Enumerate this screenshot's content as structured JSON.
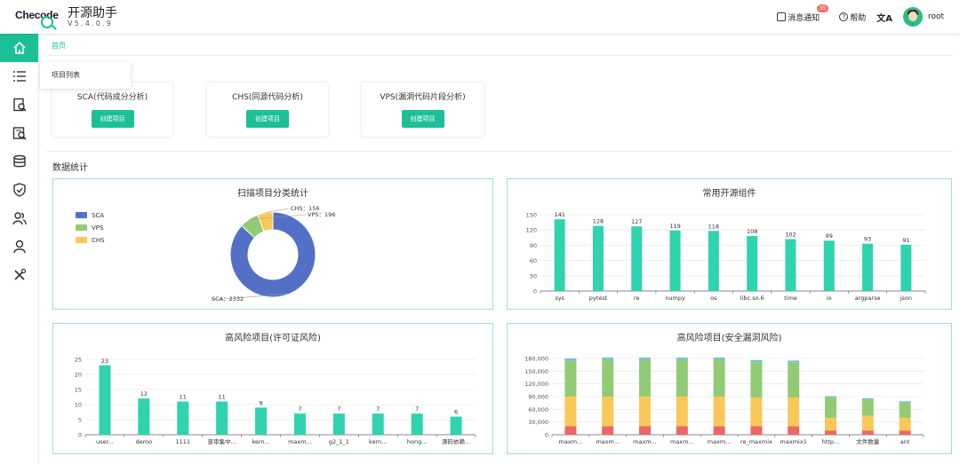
{
  "header": {
    "app_name": "开源助手",
    "version": "V5.4.0.9",
    "notice_label": "消息通知",
    "notice_count": "35",
    "help_label": "帮助",
    "lang_icon": "文A",
    "user_name": "root"
  },
  "breadcrumb": "首页",
  "tooltip": "项目列表",
  "cards": [
    {
      "title": "SCA(代码成分分析)",
      "button": "创建项目"
    },
    {
      "title": "CHS(同源代码分析)",
      "button": "创建项目"
    },
    {
      "title": "VPS(漏洞代码片段分析)",
      "button": "创建项目"
    }
  ],
  "section_title": "数据统计",
  "panels": {
    "pie_title": "扫描项目分类统计",
    "components_title": "常用开源组件",
    "license_title": "高风险项目(许可证风险)",
    "vuln_title": "高风险项目(安全漏洞风险)"
  },
  "colors": {
    "accent": "#1dbf97",
    "bar": "#2fd3ae",
    "sca": "#5470c6",
    "vps": "#91cc75",
    "chs": "#fac858",
    "red": "#ee6666",
    "blue": "#73c0de"
  },
  "chart_data": [
    {
      "type": "pie",
      "categories": [
        "SCA",
        "VPS",
        "CHS"
      ],
      "values": [
        2332,
        196,
        156
      ],
      "labels": [
        "SCA：2332",
        "VPS：196",
        "CHS：156"
      ],
      "legend": "left"
    },
    {
      "type": "bar",
      "categories": [
        "sys",
        "pytest",
        "re",
        "numpy",
        "os",
        "libc.so.6",
        "time",
        "io",
        "argparse",
        "json"
      ],
      "values": [
        141,
        128,
        127,
        119,
        118,
        108,
        102,
        99,
        93,
        91
      ],
      "ylim": [
        0,
        150
      ],
      "yticks": [
        "0",
        "30",
        "60",
        "90",
        "120",
        "150"
      ]
    },
    {
      "type": "bar",
      "categories": [
        "user...",
        "demo",
        "1111",
        "普审集中...",
        "kern...",
        "maxm...",
        "g2_1_1",
        "kern...",
        "hong...",
        "源码依赖..."
      ],
      "values": [
        23,
        12,
        11,
        11,
        9,
        7,
        7,
        7,
        7,
        6
      ],
      "ylim": [
        0,
        25
      ],
      "yticks": [
        "0",
        "5",
        "10",
        "15",
        "20",
        "25"
      ]
    },
    {
      "type": "bar",
      "stacked": true,
      "categories": [
        "maxm...",
        "maxm...",
        "maxm...",
        "maxm...",
        "maxm...",
        "re_maxmix",
        "maxmix1",
        "http...",
        "文件数量",
        "ant"
      ],
      "series": [
        {
          "color": "#ee6666",
          "values": [
            20000,
            20000,
            20000,
            20000,
            20000,
            20000,
            20000,
            10000,
            10000,
            10000
          ]
        },
        {
          "color": "#fac858",
          "values": [
            70000,
            70000,
            70000,
            70000,
            70000,
            68000,
            68000,
            30000,
            35000,
            30000
          ]
        },
        {
          "color": "#91cc75",
          "values": [
            85000,
            87000,
            87000,
            87000,
            87000,
            83000,
            82000,
            48000,
            38000,
            36000
          ]
        },
        {
          "color": "#73c0de",
          "values": [
            5000,
            5000,
            5000,
            5000,
            5000,
            5000,
            5000,
            3000,
            3000,
            3000
          ]
        }
      ],
      "ylim": [
        0,
        180000
      ],
      "yticks": [
        "0",
        "30,000",
        "60,000",
        "90,000",
        "120,000",
        "150,000",
        "180,000"
      ]
    }
  ]
}
